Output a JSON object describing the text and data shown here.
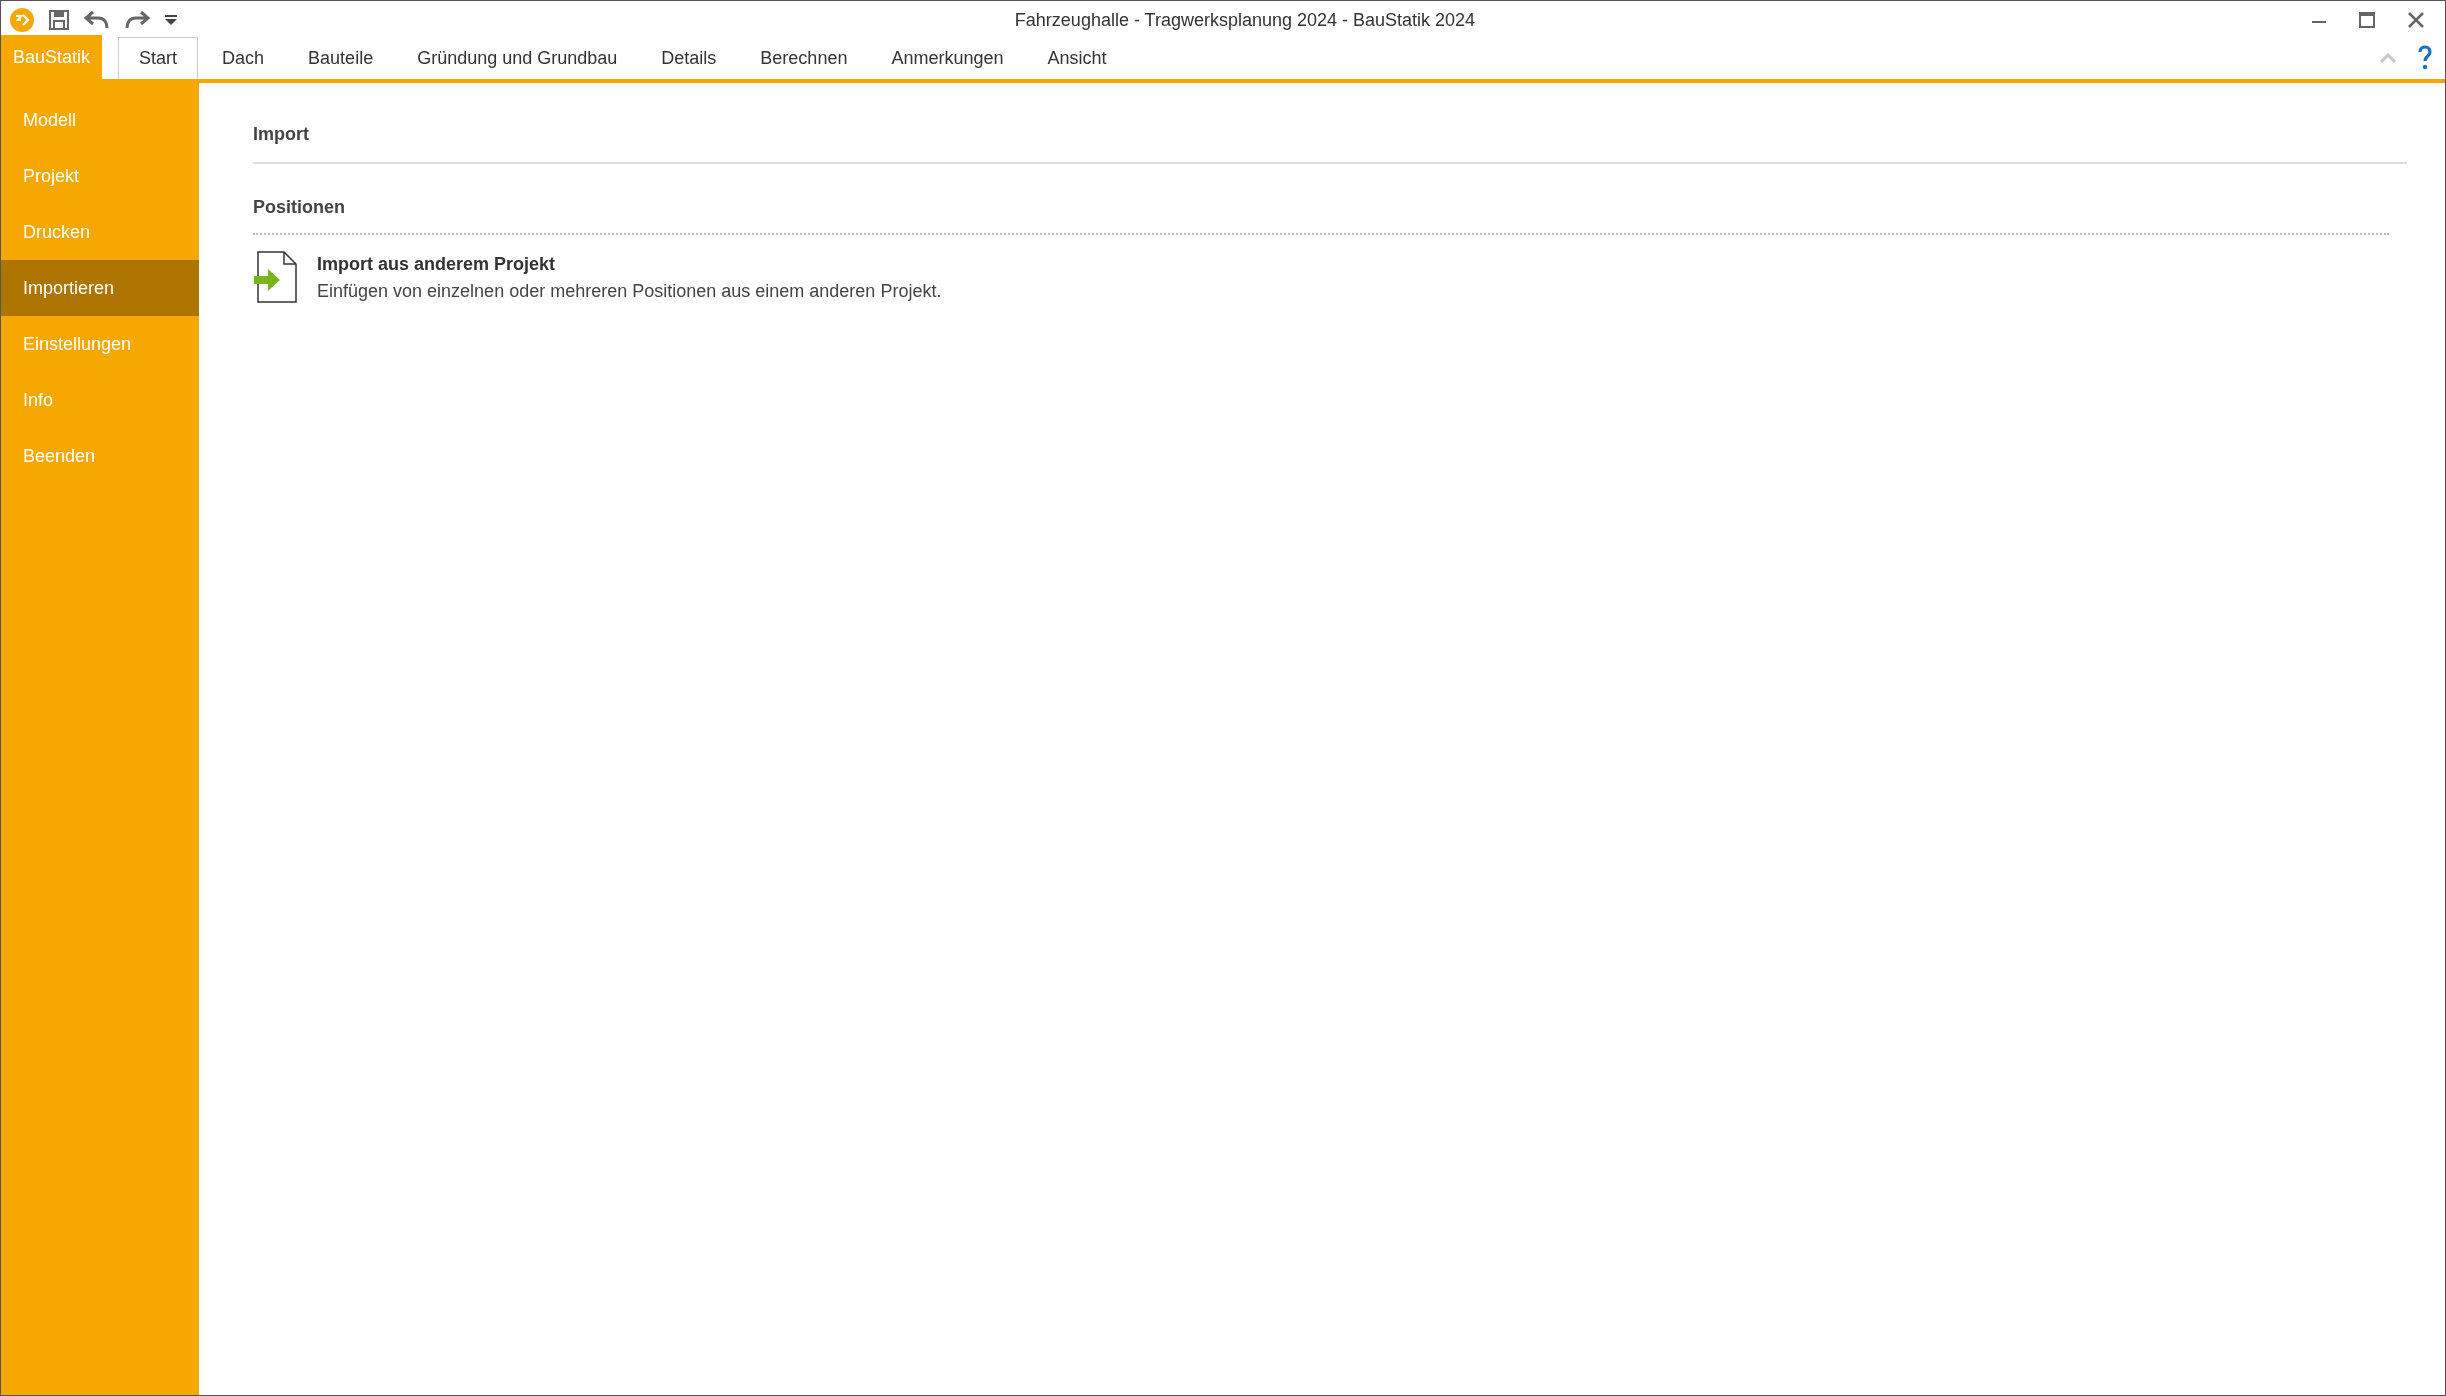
{
  "window": {
    "title": "Fahrzeughalle - Tragwerksplanung 2024 - BauStatik 2024"
  },
  "app_tab": "BauStatik",
  "tabs": [
    {
      "label": "Start",
      "selected": true
    },
    {
      "label": "Dach",
      "selected": false
    },
    {
      "label": "Bauteile",
      "selected": false
    },
    {
      "label": "Gründung und Grundbau",
      "selected": false
    },
    {
      "label": "Details",
      "selected": false
    },
    {
      "label": "Berechnen",
      "selected": false
    },
    {
      "label": "Anmerkungen",
      "selected": false
    },
    {
      "label": "Ansicht",
      "selected": false
    }
  ],
  "sidebar": {
    "items": [
      {
        "label": "Modell",
        "selected": false
      },
      {
        "label": "Projekt",
        "selected": false
      },
      {
        "label": "Drucken",
        "selected": false
      },
      {
        "label": "Importieren",
        "selected": true
      },
      {
        "label": "Einstellungen",
        "selected": false
      },
      {
        "label": "Info",
        "selected": false
      },
      {
        "label": "Beenden",
        "selected": false
      }
    ]
  },
  "content": {
    "heading": "Import",
    "section": "Positionen",
    "items": [
      {
        "title": "Import aus anderem Projekt",
        "description": "Einfügen von einzelnen oder mehreren Positionen aus einem anderen Projekt."
      }
    ]
  }
}
